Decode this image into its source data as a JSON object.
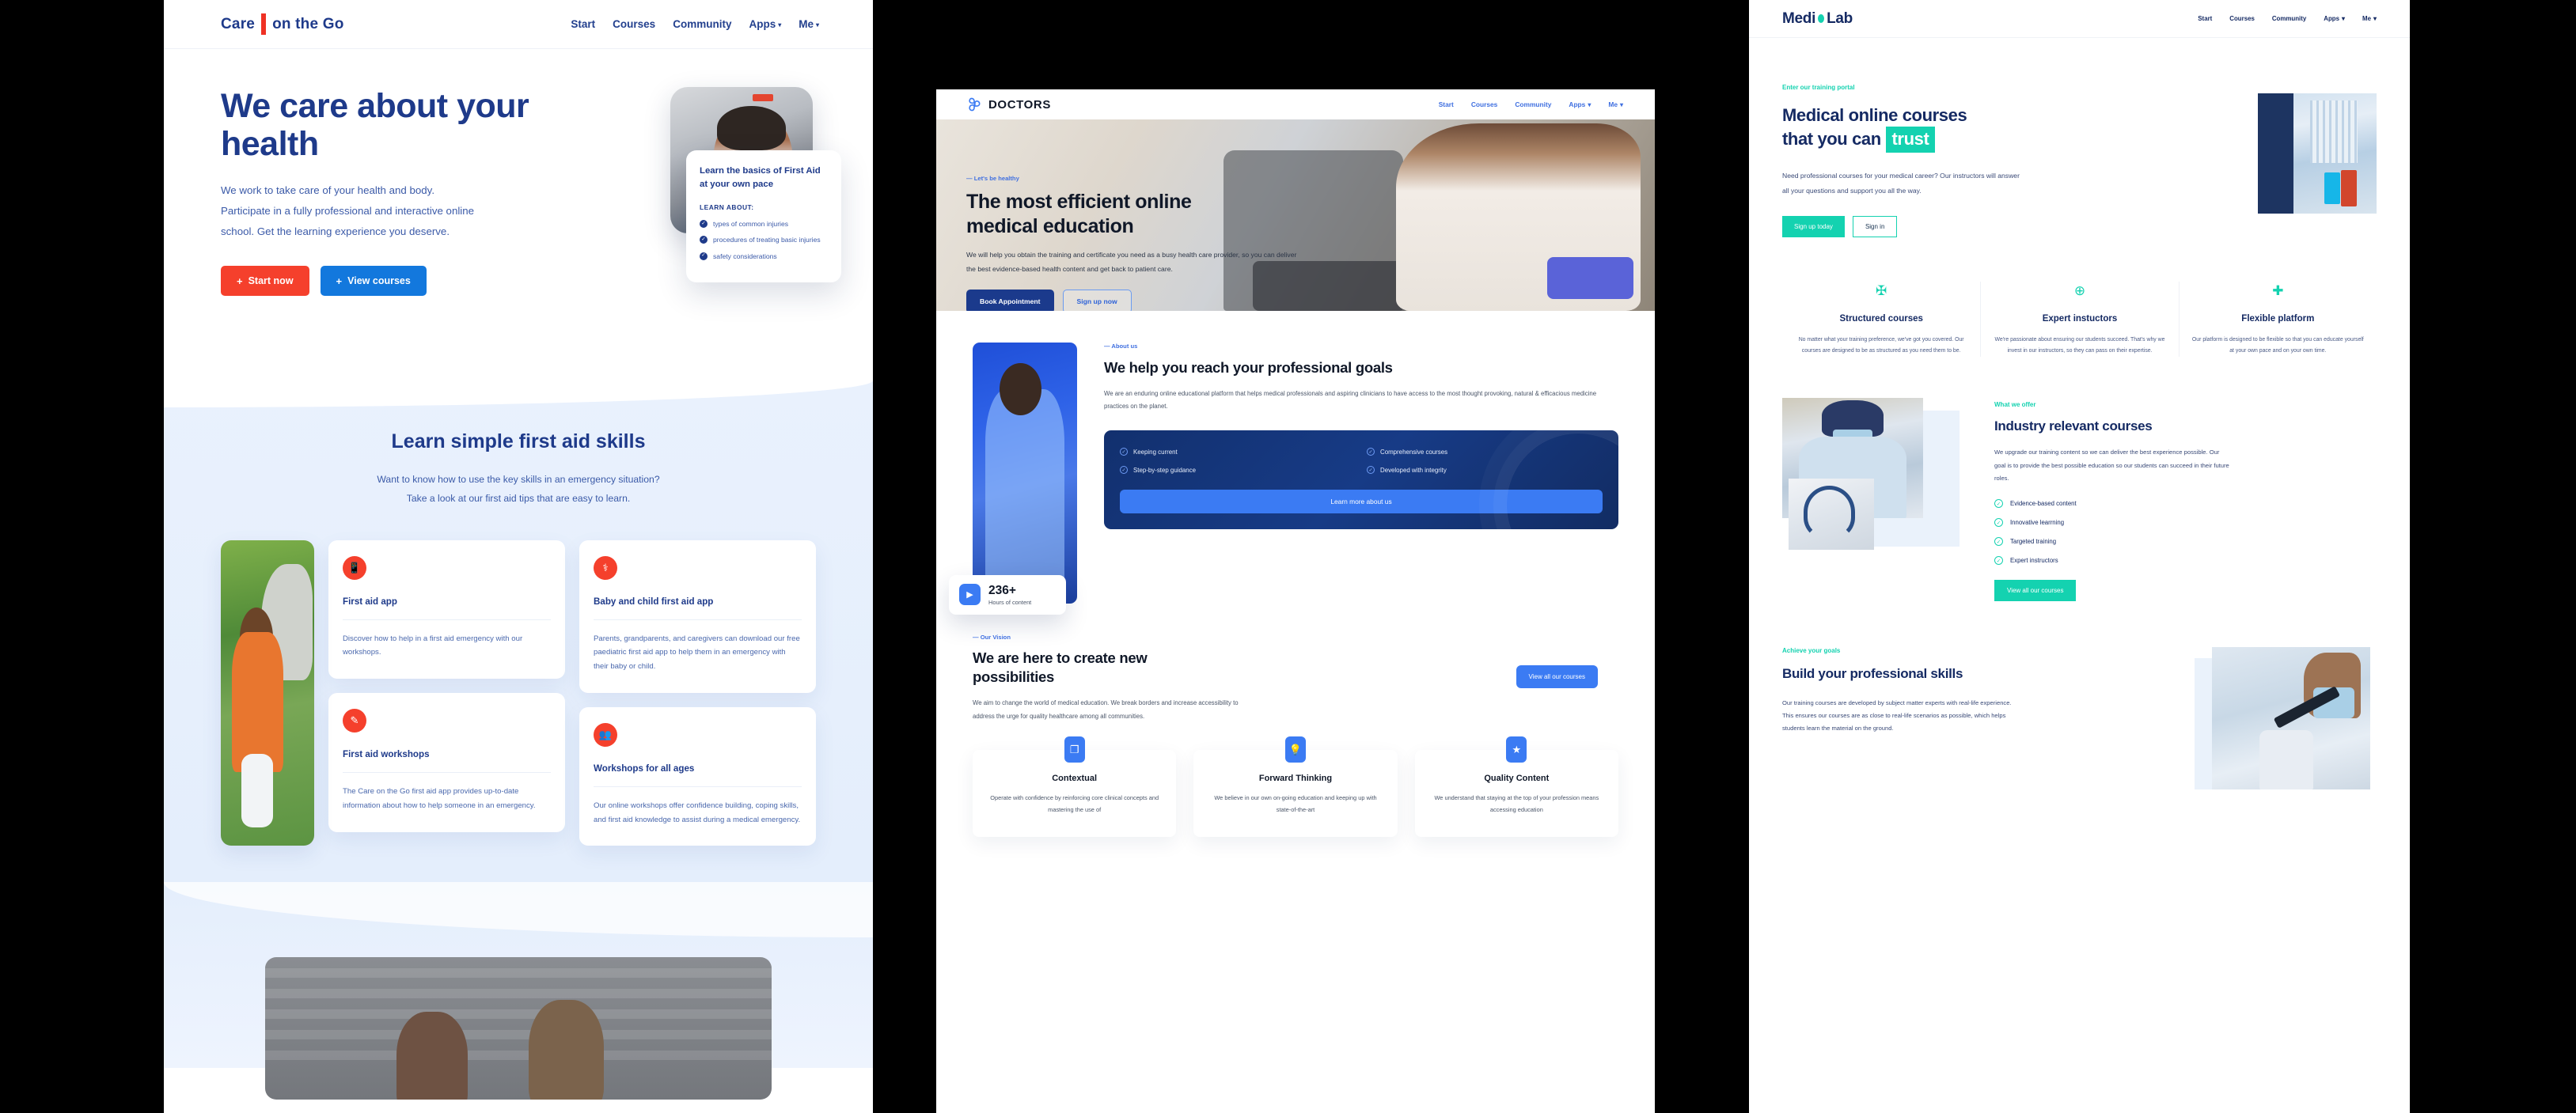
{
  "panels": {
    "care": {
      "logo": {
        "left": "Care",
        "right": "on the Go"
      },
      "nav": [
        {
          "label": "Start"
        },
        {
          "label": "Courses"
        },
        {
          "label": "Community"
        },
        {
          "label": "Apps",
          "caret": "▾"
        },
        {
          "label": "Me",
          "caret": "▾"
        }
      ],
      "hero": {
        "title": "We care about your health",
        "paragraph": "We work to take care of your health and body. Participate in a fully professional and interactive online school. Get the learning experience you deserve.",
        "primary_button": "Start now",
        "secondary_button": "View courses",
        "plus_glyph": "+"
      },
      "hero_card": {
        "title": "Learn the basics of First Aid at your own pace",
        "learn_about_label": "LEARN ABOUT:",
        "items": [
          "types of common injuries",
          "procedures of treating basic injuries",
          "safety considerations"
        ],
        "tick_glyph": "✓"
      },
      "skills": {
        "heading": "Learn simple first aid skills",
        "subtitle_line1": "Want to know how to use the key skills in an emergency situation?",
        "subtitle_line2": "Take a look at our first aid tips that are easy to learn.",
        "cards": [
          {
            "icon": "mobile-phone-icon",
            "glyph": "📱",
            "title": "First aid app",
            "body": "Discover how to help in a first aid emergency with our workshops."
          },
          {
            "icon": "baby-care-icon",
            "glyph": "⚕",
            "title": "Baby and child first aid app",
            "body": "Parents, grandparents, and caregivers can download our free paediatric first aid app to help them in an emergency with their baby or child."
          },
          {
            "icon": "pencil-icon",
            "glyph": "✎",
            "title": "First aid workshops",
            "body": "The Care on the Go first aid app provides up-to-date information about how to help someone in an emergency."
          },
          {
            "icon": "people-group-icon",
            "glyph": "👥",
            "title": "Workshops for all ages",
            "body": "Our online workshops offer confidence building, coping skills, and first aid knowledge to assist during a medical emergency."
          }
        ]
      }
    },
    "doctors": {
      "logo": "DOCTORS",
      "nav": [
        {
          "label": "Start"
        },
        {
          "label": "Courses"
        },
        {
          "label": "Community"
        },
        {
          "label": "Apps",
          "caret": "▾"
        },
        {
          "label": "Me",
          "caret": "▾"
        }
      ],
      "hero": {
        "kicker": "— Let's be healthy",
        "title": "The most efficient online medical education",
        "paragraph": "We will help you obtain the training and certificate you need as a busy health care provider, so you can deliver the best evidence-based health content and get back to patient care.",
        "primary_button": "Book Appointment",
        "secondary_button": "Sign up now"
      },
      "about": {
        "kicker": "— About us",
        "title": "We help you reach your professional goals",
        "paragraph": "We are an enduring online educational platform that helps medical professionals and aspiring clinicians to have access to the most thought provoking, natural & efficacious medicine practices on the planet.",
        "features": [
          "Keeping current",
          "Comprehensive courses",
          "Step-by-step guidance",
          "Developed with integrity"
        ],
        "check_glyph": "✓",
        "cta": "Learn more about us",
        "stat_value": "236+",
        "stat_label": "Hours of content",
        "play_glyph": "▶"
      },
      "vision": {
        "kicker": "— Our Vision",
        "title": "We are here to create new possibilities",
        "paragraph": "We aim to change the world of medical education. We break borders and increase accessibility to address the urge for quality healthcare among all communities.",
        "cta": "View all our courses",
        "cards": [
          {
            "icon": "books-icon",
            "glyph": "❐",
            "title": "Contextual",
            "body": "Operate with confidence by reinforcing core clinical concepts and mastering the use of"
          },
          {
            "icon": "lightbulb-icon",
            "glyph": "💡",
            "title": "Forward Thinking",
            "body": "We believe in our own on-going education and keeping up with state-of-the-art"
          },
          {
            "icon": "star-icon",
            "glyph": "★",
            "title": "Quality Content",
            "body": "We understand that staying at the top of your profession means accessing education"
          }
        ]
      }
    },
    "medilab": {
      "logo": {
        "left": "Medi",
        "right": "Lab"
      },
      "nav": [
        {
          "label": "Start"
        },
        {
          "label": "Courses"
        },
        {
          "label": "Community"
        },
        {
          "label": "Apps",
          "caret": "▾"
        },
        {
          "label": "Me",
          "caret": "▾"
        }
      ],
      "hero": {
        "kicker": "Enter our training portal",
        "title_line1": "Medical online courses",
        "title_line2_pre": "that you can",
        "title_highlight": "trust",
        "paragraph": "Need professional courses for your medical career? Our instructors will answer all your questions and support you all the way.",
        "primary_button": "Sign up today",
        "secondary_button": "Sign in"
      },
      "features": [
        {
          "icon": "medical-book-icon",
          "glyph": "✠",
          "title": "Structured courses",
          "body": "No matter what your training preference, we've got you covered. Our courses are designed to be as structured as you need them to be."
        },
        {
          "icon": "chat-medical-icon",
          "glyph": "⊕",
          "title": "Expert instuctors",
          "body": "We're passionate about ensuring our students succeed. That's why we invest in our instructors, so they can pass on their expertise."
        },
        {
          "icon": "hand-care-icon",
          "glyph": "✚",
          "title": "Flexible platform",
          "body": "Our platform is designed to be flexible so that you can educate yourself at your own pace and on your own time."
        }
      ],
      "industry": {
        "kicker": "What we offer",
        "title": "Industry relevant courses",
        "paragraph": "We upgrade our training content so we can deliver the best experience possible. Our goal is to provide the best possible education so our students can succeed in their future roles.",
        "list": [
          "Evidence-based content",
          "Innovative learrning",
          "Targeted training",
          "Expert instructors"
        ],
        "check_glyph": "✓",
        "cta": "View all our courses"
      },
      "build": {
        "kicker": "Achieve your goals",
        "title": "Build your professional skills",
        "paragraph": "Our training courses are developed by subject matter experts with real-life experience. This ensures our courses are as close to real-life scenarios as possible, which helps students learn the material on the ground."
      }
    }
  },
  "colors": {
    "care_blue": "#1e3a8a",
    "care_red": "#f5402c",
    "care_btn_blue": "#1378dd",
    "doctors_blue": "#3b7bf3",
    "doctors_navy": "#1b3a8c",
    "medilab_navy": "#152a63",
    "medilab_teal": "#14d2b0",
    "backdrop": "#000000"
  }
}
